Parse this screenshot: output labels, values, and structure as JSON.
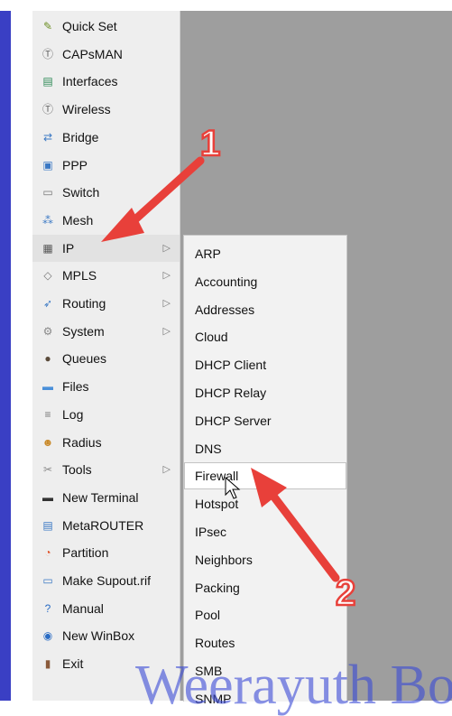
{
  "menu": {
    "items": [
      {
        "label": "Quick Set",
        "icon": "quick-set-icon"
      },
      {
        "label": "CAPsMAN",
        "icon": "capsman-icon"
      },
      {
        "label": "Interfaces",
        "icon": "interfaces-icon"
      },
      {
        "label": "Wireless",
        "icon": "wireless-icon"
      },
      {
        "label": "Bridge",
        "icon": "bridge-icon"
      },
      {
        "label": "PPP",
        "icon": "ppp-icon"
      },
      {
        "label": "Switch",
        "icon": "switch-icon"
      },
      {
        "label": "Mesh",
        "icon": "mesh-icon"
      },
      {
        "label": "IP",
        "icon": "ip-icon",
        "submenu": true
      },
      {
        "label": "MPLS",
        "icon": "mpls-icon",
        "submenu": true
      },
      {
        "label": "Routing",
        "icon": "routing-icon",
        "submenu": true
      },
      {
        "label": "System",
        "icon": "system-icon",
        "submenu": true
      },
      {
        "label": "Queues",
        "icon": "queues-icon"
      },
      {
        "label": "Files",
        "icon": "files-icon"
      },
      {
        "label": "Log",
        "icon": "log-icon"
      },
      {
        "label": "Radius",
        "icon": "radius-icon"
      },
      {
        "label": "Tools",
        "icon": "tools-icon",
        "submenu": true
      },
      {
        "label": "New Terminal",
        "icon": "terminal-icon"
      },
      {
        "label": "MetaROUTER",
        "icon": "metarouter-icon"
      },
      {
        "label": "Partition",
        "icon": "partition-icon"
      },
      {
        "label": "Make Supout.rif",
        "icon": "supout-icon"
      },
      {
        "label": "Manual",
        "icon": "manual-icon"
      },
      {
        "label": "New WinBox",
        "icon": "winbox-icon"
      },
      {
        "label": "Exit",
        "icon": "exit-icon"
      }
    ]
  },
  "submenu": {
    "items": [
      "ARP",
      "Accounting",
      "Addresses",
      "Cloud",
      "DHCP Client",
      "DHCP Relay",
      "DHCP Server",
      "DNS",
      "Firewall",
      "Hotspot",
      "IPsec",
      "Neighbors",
      "Packing",
      "Pool",
      "Routes",
      "SMB",
      "SNMP"
    ],
    "highlighted": "Firewall"
  },
  "annotations": {
    "step1": "1",
    "step2": "2",
    "arrow_color": "#e8403a"
  },
  "watermark": "Weerayuth Bo",
  "colors": {
    "accent_bar": "#3a3fc4",
    "desktop": "#9e9e9e",
    "menu_bg": "#eeeeee"
  }
}
